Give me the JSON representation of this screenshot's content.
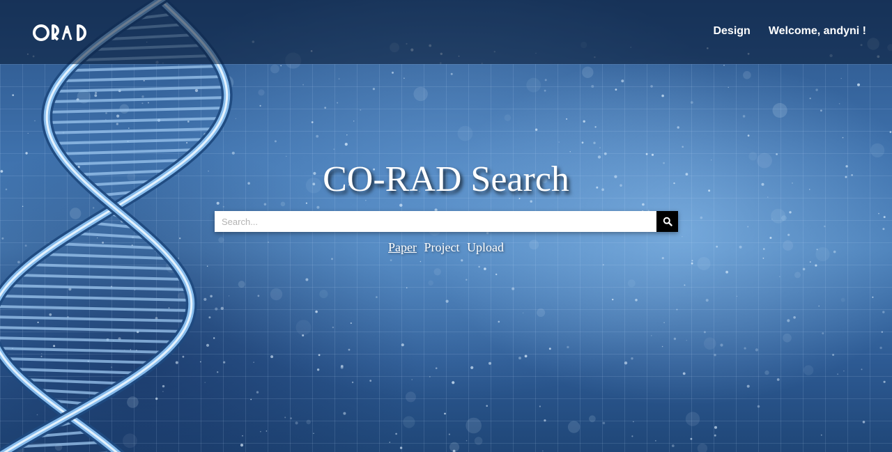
{
  "header": {
    "logo_text": "ORAD",
    "nav": {
      "design_label": "Design",
      "welcome_label": "Welcome, andyni !"
    }
  },
  "main": {
    "title": "CO-RAD Search",
    "search": {
      "placeholder": "Search...",
      "value": "",
      "button_icon": "search-icon"
    },
    "filters": [
      {
        "label": "Paper",
        "active": true
      },
      {
        "label": "Project",
        "active": false
      },
      {
        "label": "Upload",
        "active": false
      }
    ]
  },
  "colors": {
    "background": "#3f72ad",
    "topbar": "#08183299",
    "search_button": "#000000",
    "text": "#ffffff"
  }
}
